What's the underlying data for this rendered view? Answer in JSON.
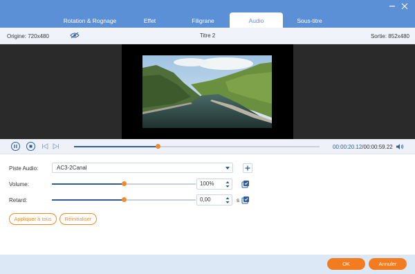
{
  "tabs": [
    {
      "label": "Rotation & Rognage"
    },
    {
      "label": "Effet"
    },
    {
      "label": "Filigrane"
    },
    {
      "label": "Audio"
    },
    {
      "label": "Sous-titre"
    }
  ],
  "active_tab": "Audio",
  "infobar": {
    "origin": "Origine: 720x480",
    "title": "Titre 2",
    "output": "Sortie: 852x480"
  },
  "playback": {
    "current_time": "00:00:20.12",
    "total_time": "/00:00:59.22",
    "progress": 0.34
  },
  "audio": {
    "track_label": "Piste Audio:",
    "track_value": "AC3-2Canal",
    "volume_label": "Volume:",
    "volume_value": "100%",
    "volume_level": 0.5,
    "delay_label": "Retard:",
    "delay_value": "0,00",
    "delay_unit": "s",
    "delay_level": 0.5
  },
  "buttons": {
    "apply_all": "Appliquer à tous",
    "reset": "Réinitialiser",
    "ok": "OK",
    "cancel": "Annuler"
  },
  "colors": {
    "header": "#5b8fd6",
    "accent": "#f47c20",
    "primary": "#2e5b9c"
  }
}
